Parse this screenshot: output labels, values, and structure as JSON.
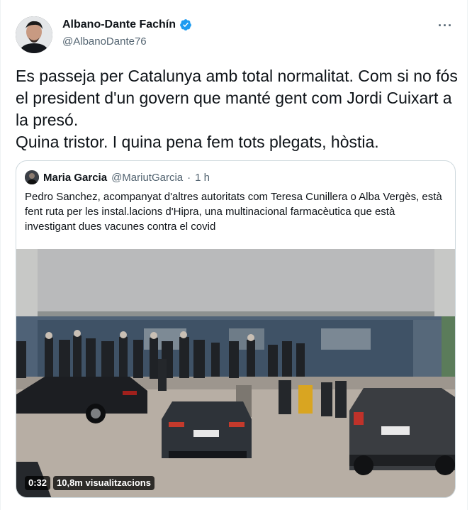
{
  "author": {
    "name": "Albano-Dante Fachín",
    "handle": "@AlbanoDante76",
    "verified": true
  },
  "tweet_text": "Es passeja per Catalunya amb total normalitat. Com si no fós el president d'un govern que manté gent com Jordi Cuixart a la presó.\nQuina tristor. I quina pena fem tots plegats, hòstia.",
  "more_icon": "···",
  "quoted": {
    "name": "Maria Garcia",
    "handle": "@MariutGarcia",
    "separator": "·",
    "time": "1 h",
    "text": "Pedro Sanchez, acompanyat d'altres autoritats com Teresa Cunillera o Alba Vergès, està fent ruta per les instal.lacions d'Hipra, una multinacional farmacèutica que està investigant dues vacunes contra el covid",
    "video": {
      "duration": "0:32",
      "views": "10,8m visualitzacions"
    }
  },
  "colors": {
    "verified_badge": "#1d9bf0",
    "secondary_text": "#536471",
    "border": "#cfd9de"
  }
}
